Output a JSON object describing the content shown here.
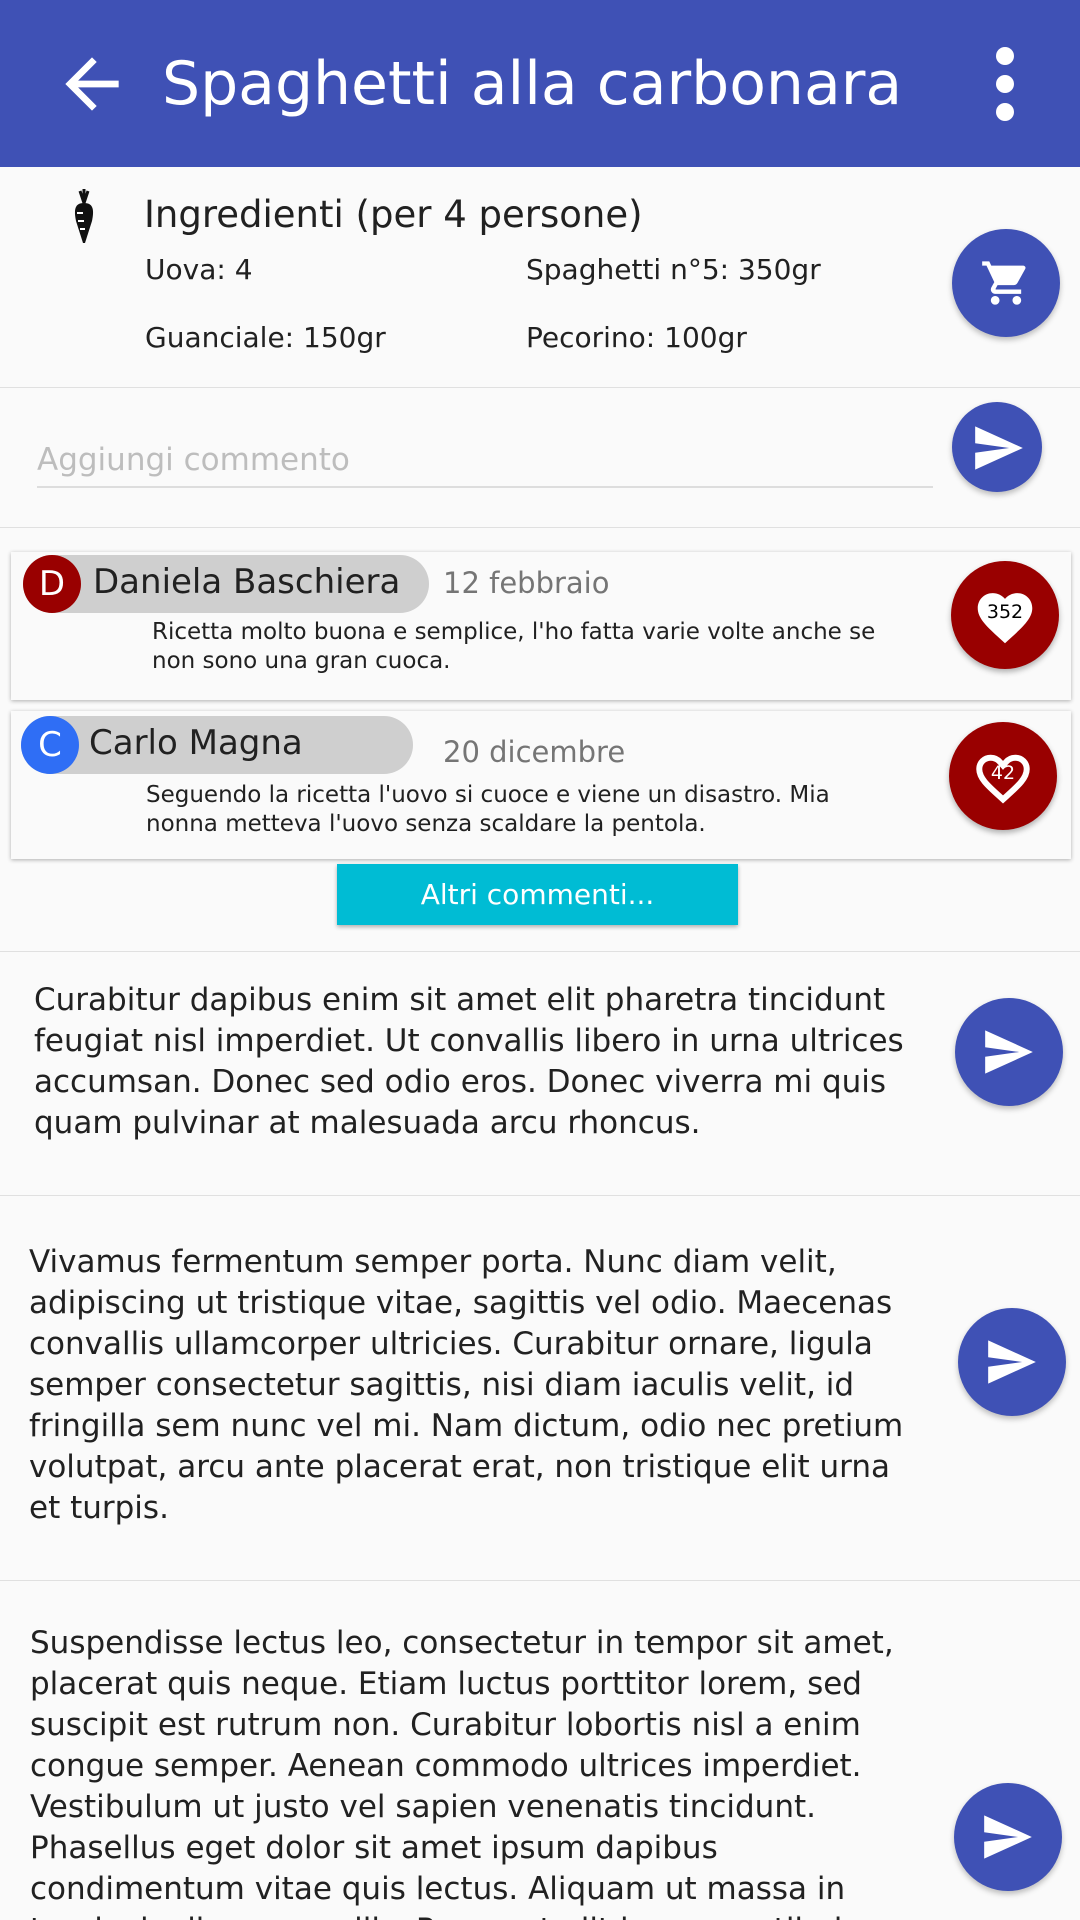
{
  "appbar": {
    "title": "Spaghetti alla carbonara",
    "back_icon": "arrow-back-icon",
    "menu_icon": "more-vert-icon",
    "color": "#3f51b5"
  },
  "ingredients": {
    "title": "Ingredienti (per 4 persone)",
    "icon": "carrot-icon",
    "items": [
      "Uova: 4",
      "Spaghetti n°5: 350gr",
      "Guanciale: 150gr",
      "Pecorino: 100gr"
    ],
    "cart_icon": "shopping-cart-icon"
  },
  "comment_input": {
    "placeholder": "Aggiungi commento",
    "value": ""
  },
  "comments": [
    {
      "initial": "D",
      "avatar_color": "#990000",
      "name": "Daniela Baschiera",
      "date": "12 febbraio",
      "text": "Ricetta molto buona e semplice, l'ho fatta varie volte anche se non sono una gran cuoca.",
      "likes": "352"
    },
    {
      "initial": "C",
      "avatar_color": "#2f6ef5",
      "name": "Carlo Magna",
      "date": "20 dicembre",
      "text": "Seguendo la ricetta l'uovo si cuoce e viene un disastro. Mia nonna metteva l'uovo senza scaldare la pentola.",
      "likes": "42"
    }
  ],
  "more_comments_label": "Altri commenti...",
  "steps": [
    "Curabitur dapibus enim sit amet elit pharetra tincidunt feugiat nisl imperdiet. Ut convallis libero in urna ultrices accumsan. Donec sed odio eros. Donec viverra mi quis quam pulvinar at malesuada arcu rhoncus.",
    "Vivamus fermentum semper porta. Nunc diam velit, adipiscing ut tristique vitae, sagittis vel odio. Maecenas convallis ullamcorper ultricies. Curabitur ornare, ligula semper consectetur sagittis, nisi diam iaculis velit, id fringilla sem nunc vel mi. Nam dictum, odio nec pretium volutpat, arcu ante placerat erat, non tristique elit urna et turpis.",
    "Suspendisse lectus leo, consectetur in tempor sit amet, placerat quis neque. Etiam luctus porttitor lorem, sed suscipit est rutrum non. Curabitur lobortis nisl a enim congue semper. Aenean commodo ultrices imperdiet. Vestibulum ut justo vel sapien venenatis tincidunt. Phasellus eget dolor sit amet ipsum dapibus condimentum vitae quis lectus. Aliquam ut massa in turpis dapibus convallis. Praesent elit lacus, vestibulum at malesuada et, ornare et est."
  ],
  "colors": {
    "accent": "#3f51b5",
    "like": "#990000",
    "button": "#00bcd4"
  }
}
